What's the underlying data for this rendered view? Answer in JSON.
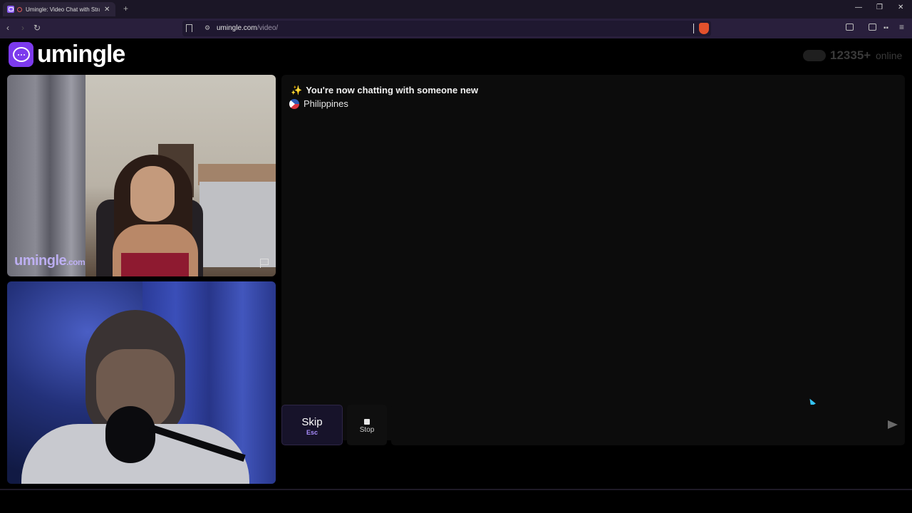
{
  "browser": {
    "tab_title": "Umingle: Video Chat with Stra",
    "tab_close": "✕",
    "new_tab": "+",
    "url_host": "umingle.com",
    "url_path": "/video/",
    "window_controls": {
      "minimize": "—",
      "restore": "❐",
      "close": "✕"
    }
  },
  "header": {
    "logo_text": "umingle",
    "online_count": "12335+",
    "online_word": "online"
  },
  "video": {
    "watermark": "umingle",
    "watermark_tld": ".com"
  },
  "chat": {
    "sparkle": "✨",
    "status_message": "You're now chatting with someone new",
    "country": "Philippines"
  },
  "controls": {
    "skip_label": "Skip",
    "skip_key": "Esc",
    "stop_label": "Stop",
    "message_placeholder": ""
  },
  "colors": {
    "brand": "#7c3aed",
    "accent_text": "#a78bfa",
    "background": "#000000",
    "chat_panel": "#0c0c0c"
  }
}
